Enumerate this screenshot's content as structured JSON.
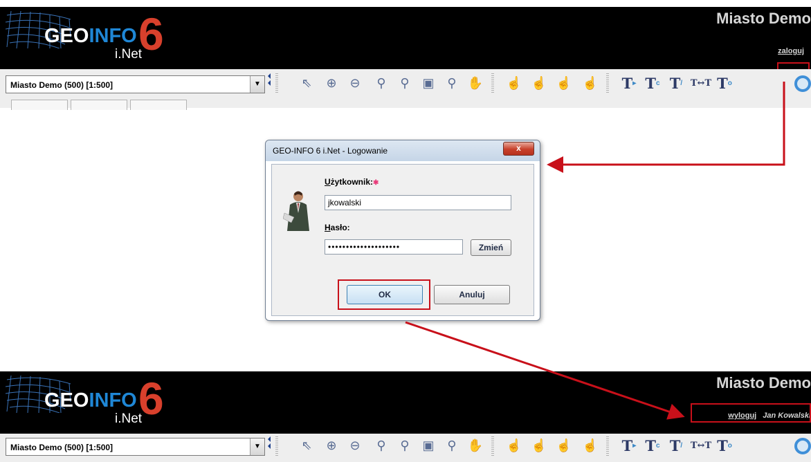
{
  "app_logo": {
    "geo": "GEO",
    "info": "INFO",
    "inet": "i.Net",
    "six": "6"
  },
  "header": {
    "city": "Miasto Demo",
    "login_link": "zaloguj",
    "logout_link": "wyloguj",
    "user_name": "Jan Kowalski"
  },
  "layer_select": {
    "value": "Miasto Demo (500) [1:500]"
  },
  "toolbar": {
    "icons": [
      "select-arrow-icon",
      "zoom-in-pin-icon",
      "zoom-out-pin-icon",
      "zoom-out-icon",
      "zoom-in-icon",
      "zoom-extent-icon",
      "zoom-plus-icon",
      "pan-hand-icon",
      "pointer-hand-icon",
      "hand-select-icon",
      "hand-check-icon",
      "hand-star-icon",
      "text-move-icon",
      "text-rotate-icon",
      "text-edit-icon",
      "text-spacing-icon",
      "text-add-icon",
      "circle-icon"
    ]
  },
  "dialog": {
    "title": "GEO-INFO 6 i.Net - Logowanie",
    "close": "x",
    "user_label_u": "U",
    "user_label_rest": "żytkownik:",
    "required_mark": "✱",
    "user_value": "jkowalski",
    "password_label_u": "H",
    "password_label_rest": "asło:",
    "password_value": "••••••••••••••••••••",
    "change_button": "Zmień",
    "ok_button": "OK",
    "cancel_button": "Anuluj"
  },
  "colors": {
    "header_bg": "#000000",
    "highlight": "#c8101a",
    "logo_blue": "#1f87d6",
    "logo_red": "#d8402c"
  }
}
